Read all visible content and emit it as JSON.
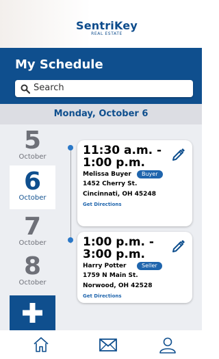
{
  "brand": {
    "name": "SentriKey",
    "tagline": "REAL ESTATE",
    "color": "#0f4f8e"
  },
  "page": {
    "title": "My Schedule"
  },
  "search": {
    "placeholder": "Search"
  },
  "date": {
    "label": "Monday, October 6"
  },
  "days": [
    {
      "num": "5",
      "month": "October",
      "selected": false
    },
    {
      "num": "6",
      "month": "October",
      "selected": true
    },
    {
      "num": "7",
      "month": "October",
      "selected": false
    },
    {
      "num": "8",
      "month": "October",
      "selected": false
    }
  ],
  "appointments": [
    {
      "time_start": "11:30 a.m. -",
      "time_end": "1:00 p.m.",
      "name": "Melissa Buyer",
      "role": "Buyer",
      "address1": "1452 Cherry St.",
      "address2": "Cincinnati, OH 45248",
      "link": "Get Directions"
    },
    {
      "time_start": "1:00 p.m. -",
      "time_end": "3:00 p.m.",
      "name": "Harry Potter",
      "role": "Seller",
      "address1": "1759 N Main St.",
      "address2": "Norwood, OH 42528",
      "link": "Get Directions"
    }
  ],
  "add_button": {
    "icon": "plus-icon"
  },
  "nav": {
    "items": [
      "home-icon",
      "mail-icon",
      "profile-icon"
    ]
  }
}
